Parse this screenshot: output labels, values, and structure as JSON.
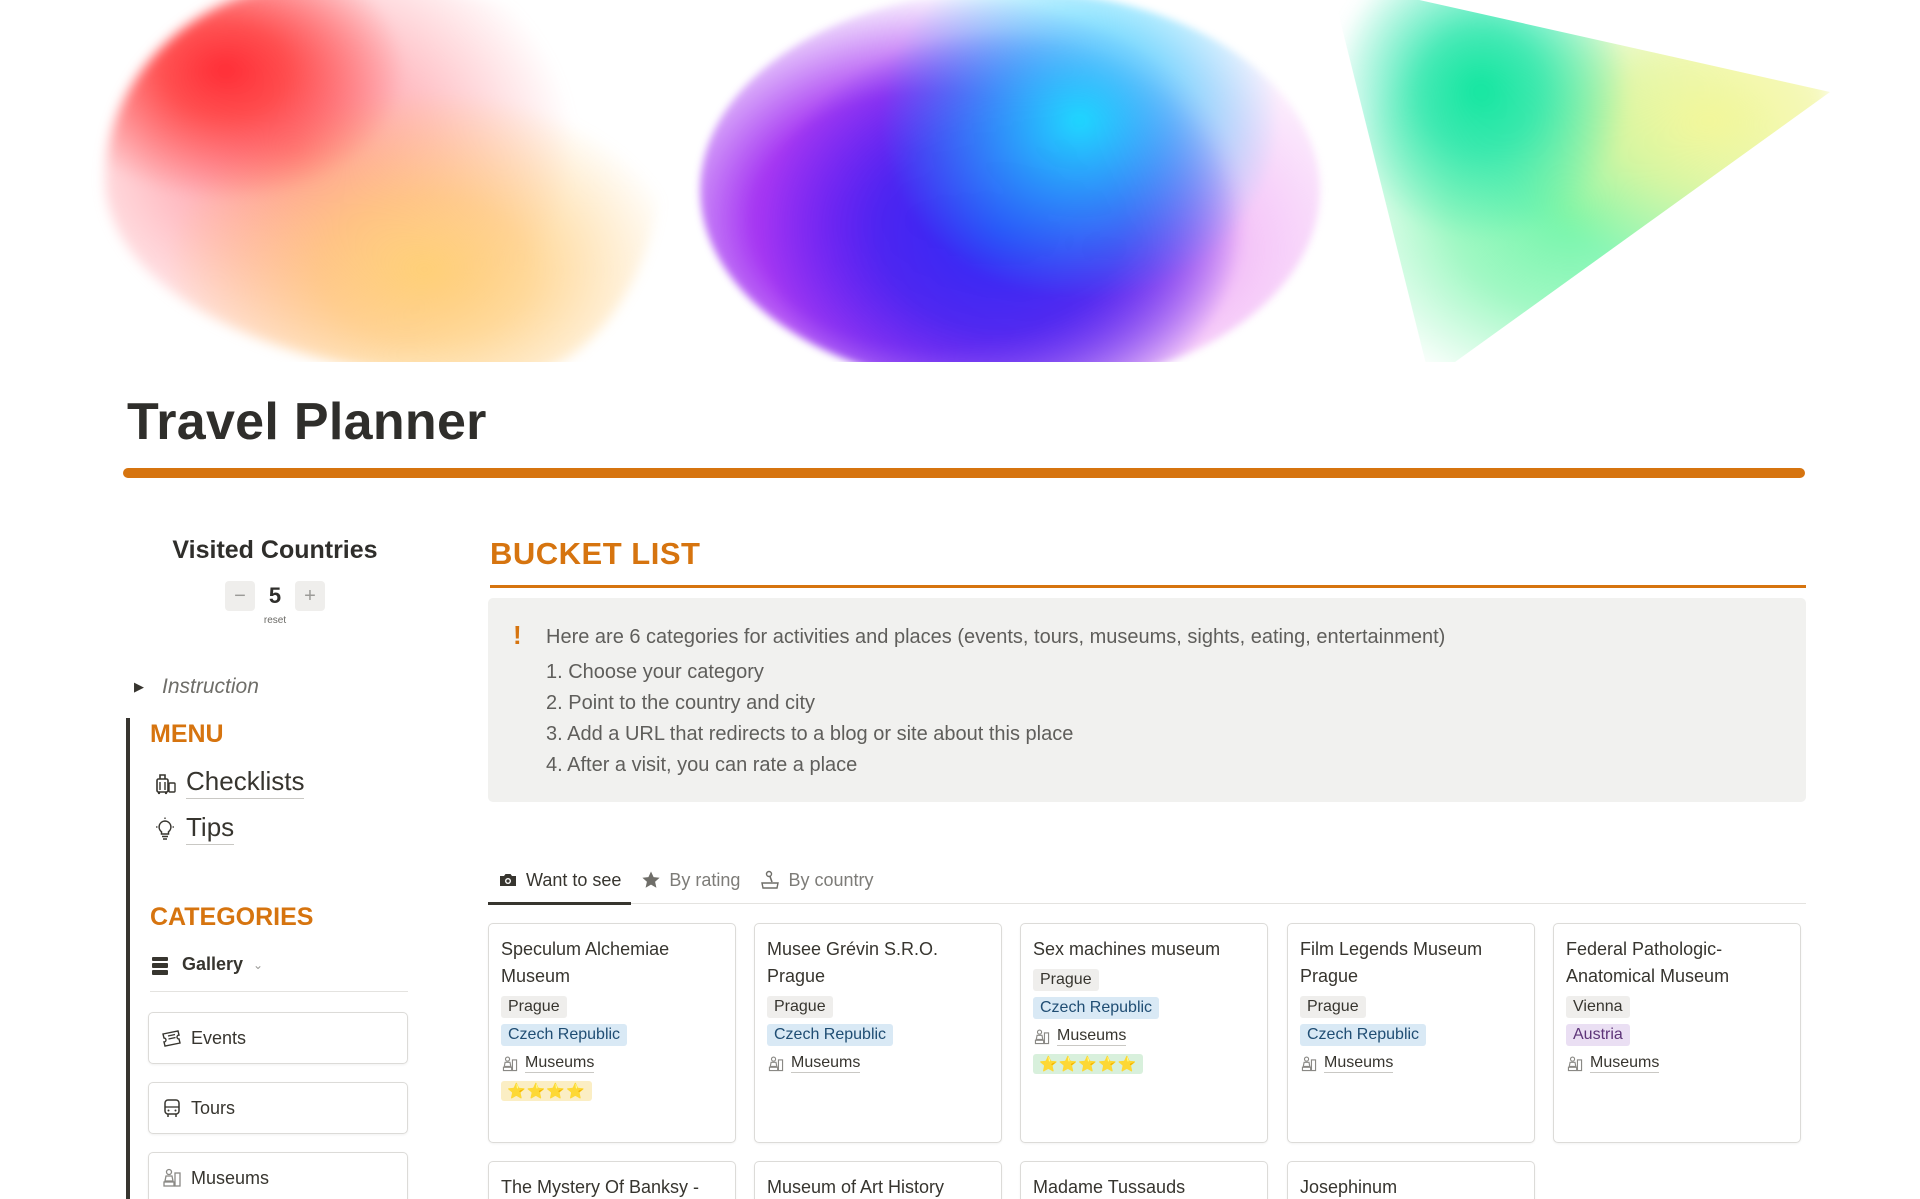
{
  "page": {
    "title": "Travel Planner"
  },
  "colors": {
    "accent": "#d6740f",
    "text": "#37352f",
    "callout_bg": "#f1f1ef"
  },
  "visited": {
    "title": "Visited Countries",
    "minus": "−",
    "value": "5",
    "plus": "+",
    "reset": "reset"
  },
  "instruction": {
    "toggle_icon": "triangle-right-icon",
    "label": "Instruction"
  },
  "menu": {
    "heading": "MENU",
    "items": [
      {
        "label": "Checklists",
        "icon": "luggage-icon"
      },
      {
        "label": "Tips",
        "icon": "lightbulb-icon"
      }
    ]
  },
  "categories": {
    "heading": "CATEGORIES",
    "view_label": "Gallery",
    "view_icon": "gallery-stack-icon",
    "items": [
      {
        "label": "Events",
        "icon": "ticket-icon"
      },
      {
        "label": "Tours",
        "icon": "bus-icon"
      },
      {
        "label": "Museums",
        "icon": "museum-icon"
      }
    ]
  },
  "bucket": {
    "title": "BUCKET LIST",
    "callout": {
      "icon": "!",
      "intro": "Here are 6 categories for activities and places (events, tours, museums, sights, eating, entertainment)",
      "steps": [
        "1. Choose your category",
        "2. Point to the country and city",
        "3. Add a URL that redirects to a blog or site about this place",
        "4. After a visit, you can rate a place"
      ]
    },
    "tabs": [
      {
        "label": "Want to see",
        "icon": "camera-icon",
        "active": true
      },
      {
        "label": "By rating",
        "icon": "star-icon",
        "active": false
      },
      {
        "label": "By country",
        "icon": "joystick-icon",
        "active": false
      }
    ],
    "cards": [
      {
        "title": "Speculum Alchemiae Museum",
        "city": "Prague",
        "country": "Czech Republic",
        "category": "Museums",
        "rating": "⭐⭐⭐⭐"
      },
      {
        "title": "Musee Grévin S.R.O. Prague",
        "city": "Prague",
        "country": "Czech Republic",
        "category": "Museums",
        "rating": ""
      },
      {
        "title": "Sex machines museum",
        "city": "Prague",
        "country": "Czech Republic",
        "category": "Museums",
        "rating": "⭐⭐⭐⭐⭐"
      },
      {
        "title": "Film Legends Museum Prague",
        "city": "Prague",
        "country": "Czech Republic",
        "category": "Museums",
        "rating": ""
      },
      {
        "title": "Federal Pathologic-Anatomical Museum",
        "city": "Vienna",
        "country": "Austria",
        "category": "Museums",
        "rating": ""
      },
      {
        "title": "The Mystery Of Banksy -"
      },
      {
        "title": "Museum of Art History"
      },
      {
        "title": "Madame Tussauds"
      },
      {
        "title": "Josephinum"
      }
    ]
  }
}
